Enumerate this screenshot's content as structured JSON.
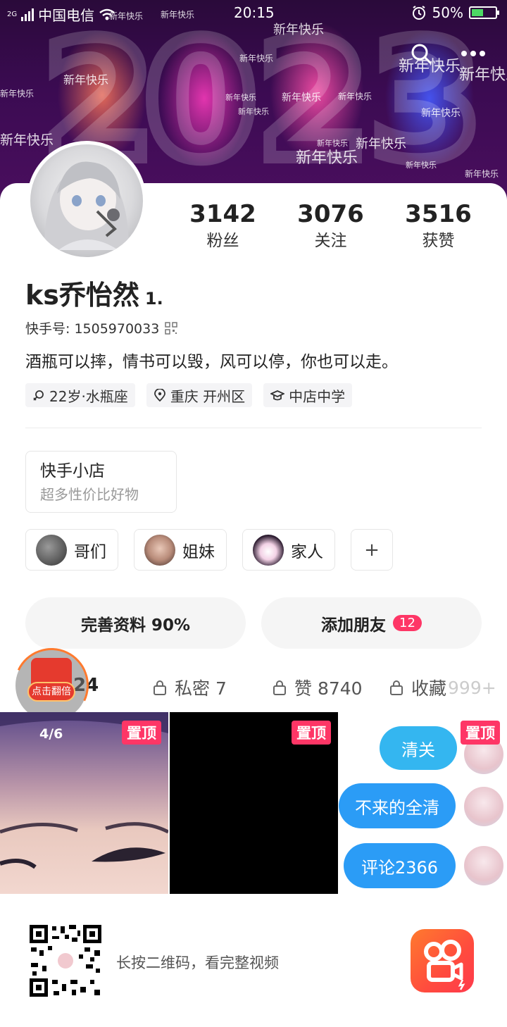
{
  "status_bar": {
    "network": "2G",
    "carrier": "中国电信",
    "time": "20:15",
    "battery": "50%",
    "battery_level": 0.5
  },
  "banner": {
    "year_digits": [
      "2",
      "0",
      "2",
      "3"
    ],
    "greeting": "新年快乐"
  },
  "header_icons": [
    "search-icon",
    "more-icon"
  ],
  "stats": [
    {
      "value": "3142",
      "label": "粉丝"
    },
    {
      "value": "3076",
      "label": "关注"
    },
    {
      "value": "3516",
      "label": "获赞"
    }
  ],
  "profile": {
    "name": "ks乔怡然",
    "level": "1.",
    "kuaishou_id": "快手号: 1505970033",
    "bio": "酒瓶可以摔，情书可以毁，风可以停，你也可以走。",
    "tags": [
      {
        "icon": "gender-icon",
        "text": "22岁·水瓶座"
      },
      {
        "icon": "location-icon",
        "text": "重庆 开州区"
      },
      {
        "icon": "school-icon",
        "text": "中店中学"
      }
    ]
  },
  "shop": {
    "title": "快手小店",
    "subtitle": "超多性价比好物"
  },
  "groups": [
    {
      "label": "哥们"
    },
    {
      "label": "姐妹"
    },
    {
      "label": "家人"
    },
    {
      "label": "+"
    }
  ],
  "actions": {
    "complete_profile": "完善资料 90%",
    "add_friends": "添加朋友",
    "add_friends_badge": "12"
  },
  "red_packet": {
    "label": "点击翻倍"
  },
  "tabs": [
    {
      "label": "24"
    },
    {
      "label": "私密 7"
    },
    {
      "label": "赞 8740"
    },
    {
      "label": "收藏",
      "extra": "999+"
    }
  ],
  "videos": [
    {
      "pinned": "置顶",
      "count": "4/6"
    },
    {
      "pinned": "置顶"
    },
    {
      "pinned": "置顶",
      "bubbles": [
        "清关",
        "不来的全清",
        "评论2366"
      ]
    }
  ],
  "footer": {
    "text": "长按二维码，看完整视频"
  },
  "colors": {
    "accent": "#fe3666",
    "bubble_blue": "#2b9cf6",
    "brand_orange": "#ff5a36"
  }
}
